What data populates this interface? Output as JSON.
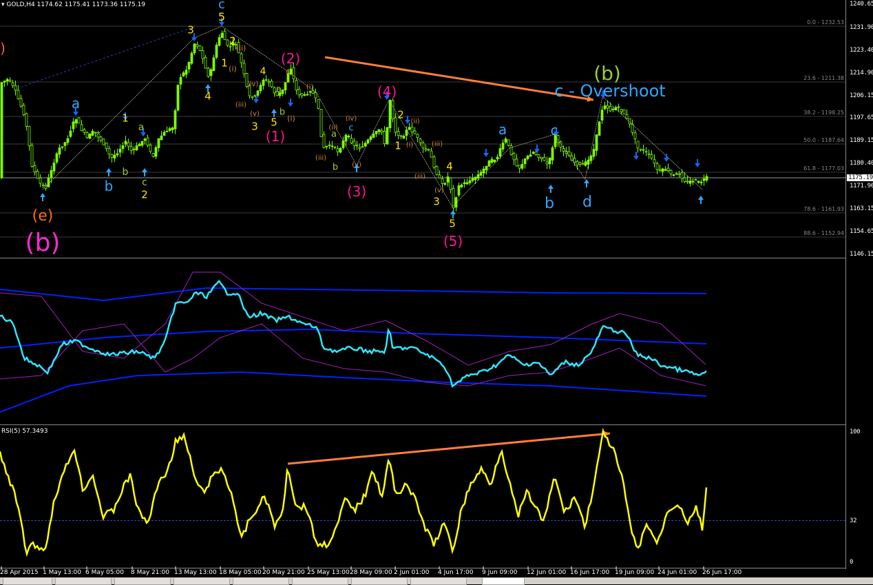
{
  "header": {
    "symbol": "GOLD,H4",
    "ohlc": "1174.62 1175.41 1173.36 1175.19"
  },
  "price_axis": {
    "labels": [
      "1240.65",
      "1231.90",
      "1223.40",
      "1214.90",
      "1206.15",
      "1197.65",
      "1189.15",
      "1180.40",
      "1171.90",
      "1163.15",
      "1154.65",
      "1146.15"
    ],
    "current": "1175.19"
  },
  "time_axis": {
    "labels": [
      "28 Apr 2015",
      "1 May 13:00",
      "6 May 05:00",
      "8 May 21:00",
      "13 May 13:00",
      "18 May 05:00",
      "20 May 21:00",
      "25 May 13:00",
      "28 May 09:00",
      "2 Jun 01:00",
      "4 Jun 17:00",
      "9 Jun 09:00",
      "12 Jun 01:00",
      "16 Jun 17:00",
      "19 Jun 09:00",
      "24 Jun 01:00",
      "26 Jun 17:00"
    ]
  },
  "fib_levels": [
    "0.0 - 1232.53",
    "23.6 - 1211.38",
    "38.2 - 1198.25",
    "50.0 - 1187.64",
    "61.8 - 1177.03",
    "78.6 - 1161.93",
    "88.6 - 1152.94"
  ],
  "wave_labels": [
    {
      "t": ")",
      "c": "#ff6a1a"
    },
    {
      "t": "(e)",
      "c": "#ff6a1a"
    },
    {
      "t": "(b)",
      "c": "#ff2ad4"
    },
    {
      "t": "a",
      "c": "#2ea8ff"
    },
    {
      "t": "b",
      "c": "#2ea8ff"
    },
    {
      "t": "1",
      "c": "#ffe600"
    },
    {
      "t": "a",
      "c": "#9acd32"
    },
    {
      "t": "b",
      "c": "#9acd32"
    },
    {
      "t": "c",
      "c": "#9acd32"
    },
    {
      "t": "2",
      "c": "#ffe600"
    },
    {
      "t": "3",
      "c": "#ffe600"
    },
    {
      "t": "4",
      "c": "#ffe600"
    },
    {
      "t": "c",
      "c": "#2ea8ff"
    },
    {
      "t": "5",
      "c": "#ffe600"
    },
    {
      "t": "2",
      "c": "#ffe600"
    },
    {
      "t": "1",
      "c": "#ffe600"
    },
    {
      "t": "(i)",
      "c": "#cd853f"
    },
    {
      "t": "(ii)",
      "c": "#cd853f"
    },
    {
      "t": "(iii)",
      "c": "#cd853f"
    },
    {
      "t": "(iv)",
      "c": "#cd853f"
    },
    {
      "t": "(v)",
      "c": "#cd853f"
    },
    {
      "t": "3",
      "c": "#ffe600"
    },
    {
      "t": "4",
      "c": "#ffe600"
    },
    {
      "t": "5",
      "c": "#ffe600"
    },
    {
      "t": "a",
      "c": "#9acd32"
    },
    {
      "t": "b",
      "c": "#9acd32"
    },
    {
      "t": "c",
      "c": "#ff6a1a"
    },
    {
      "t": "(i)",
      "c": "#cd853f"
    },
    {
      "t": "(2)",
      "c": "#ff1493"
    },
    {
      "t": "(1)",
      "c": "#ff1493"
    },
    {
      "t": "(i)",
      "c": "#cd853f"
    },
    {
      "t": "(ii)",
      "c": "#cd853f"
    },
    {
      "t": "(iii)",
      "c": "#cd853f"
    },
    {
      "t": "(iv)",
      "c": "#cd853f"
    },
    {
      "t": "a",
      "c": "#9acd32"
    },
    {
      "t": "c",
      "c": "#2ea8ff"
    },
    {
      "t": "b",
      "c": "#9acd32"
    },
    {
      "t": "(v)",
      "c": "#cd853f"
    },
    {
      "t": "(3)",
      "c": "#ff1493"
    },
    {
      "t": "(4)",
      "c": "#ff1493"
    },
    {
      "t": "1",
      "c": "#ffe600"
    },
    {
      "t": "2",
      "c": "#ffe600"
    },
    {
      "t": "(ii)",
      "c": "#cd853f"
    },
    {
      "t": "(i)",
      "c": "#cd853f"
    },
    {
      "t": "(iii)",
      "c": "#cd853f"
    },
    {
      "t": "(iii)",
      "c": "#cd853f"
    },
    {
      "t": "(v)",
      "c": "#cd853f"
    },
    {
      "t": "3",
      "c": "#ffe600"
    },
    {
      "t": "4",
      "c": "#ffe600"
    },
    {
      "t": "5",
      "c": "#ffe600"
    },
    {
      "t": "(5)",
      "c": "#ff1493"
    },
    {
      "t": "a",
      "c": "#2ea8ff"
    },
    {
      "t": "b",
      "c": "#2ea8ff"
    },
    {
      "t": "c",
      "c": "#2ea8ff"
    },
    {
      "t": "d",
      "c": "#2ea8ff"
    },
    {
      "t": "(b)",
      "c": "#9acd32"
    },
    {
      "t": "c - Overshoot",
      "c": "#2ea8ff"
    }
  ],
  "rsi": {
    "label": "RSI(5) 57.3493",
    "levels": [
      "100",
      "32",
      "0"
    ]
  },
  "colors": {
    "background": "#000000",
    "candles": "#7cfc00",
    "bollinger": "#0022ff",
    "envelope": "#a020c0",
    "oscillator": "#2ee6ff",
    "rsi": "#ffff00",
    "divergence": "#ff7f3a"
  },
  "chart_data": [
    {
      "type": "line",
      "title": "GOLD,H4",
      "xlabel": "",
      "ylabel": "",
      "x": [
        "28 Apr 2015",
        "1 May 13:00",
        "6 May 05:00",
        "8 May 21:00",
        "13 May 13:00",
        "18 May 05:00",
        "20 May 21:00",
        "25 May 13:00",
        "28 May 09:00",
        "2 Jun 01:00",
        "4 Jun 17:00",
        "9 Jun 09:00",
        "12 Jun 01:00",
        "16 Jun 17:00",
        "19 Jun 09:00",
        "24 Jun 01:00",
        "26 Jun 17:00"
      ],
      "series": [
        {
          "values": [
            1205.0,
            1174.0,
            1187.0,
            1182.0,
            1216.0,
            1224.0,
            1208.0,
            1188.0,
            1190.0,
            1183.0,
            1163.0,
            1177.0,
            1183.0,
            1182.0,
            1201.0,
            1175.0,
            1175.19
          ]
        }
      ],
      "ylim": [
        1146.15,
        1240.65
      ],
      "grid": false
    },
    {
      "type": "line",
      "title": "RSI(5) 57.3493",
      "xlabel": "",
      "ylabel": "",
      "x": [
        "28 Apr 2015",
        "1 May 13:00",
        "6 May 05:00",
        "8 May 21:00",
        "13 May 13:00",
        "18 May 05:00",
        "20 May 21:00",
        "25 May 13:00",
        "28 May 09:00",
        "2 Jun 01:00",
        "4 Jun 17:00",
        "9 Jun 09:00",
        "12 Jun 01:00",
        "16 Jun 17:00",
        "19 Jun 09:00",
        "24 Jun 01:00",
        "26 Jun 17:00"
      ],
      "series": [
        {
          "values": [
            62,
            8,
            55,
            40,
            95,
            85,
            30,
            20,
            70,
            38,
            12,
            55,
            60,
            48,
            100,
            20,
            57.35
          ]
        }
      ],
      "ylim": [
        0,
        100
      ],
      "grid": false
    }
  ]
}
